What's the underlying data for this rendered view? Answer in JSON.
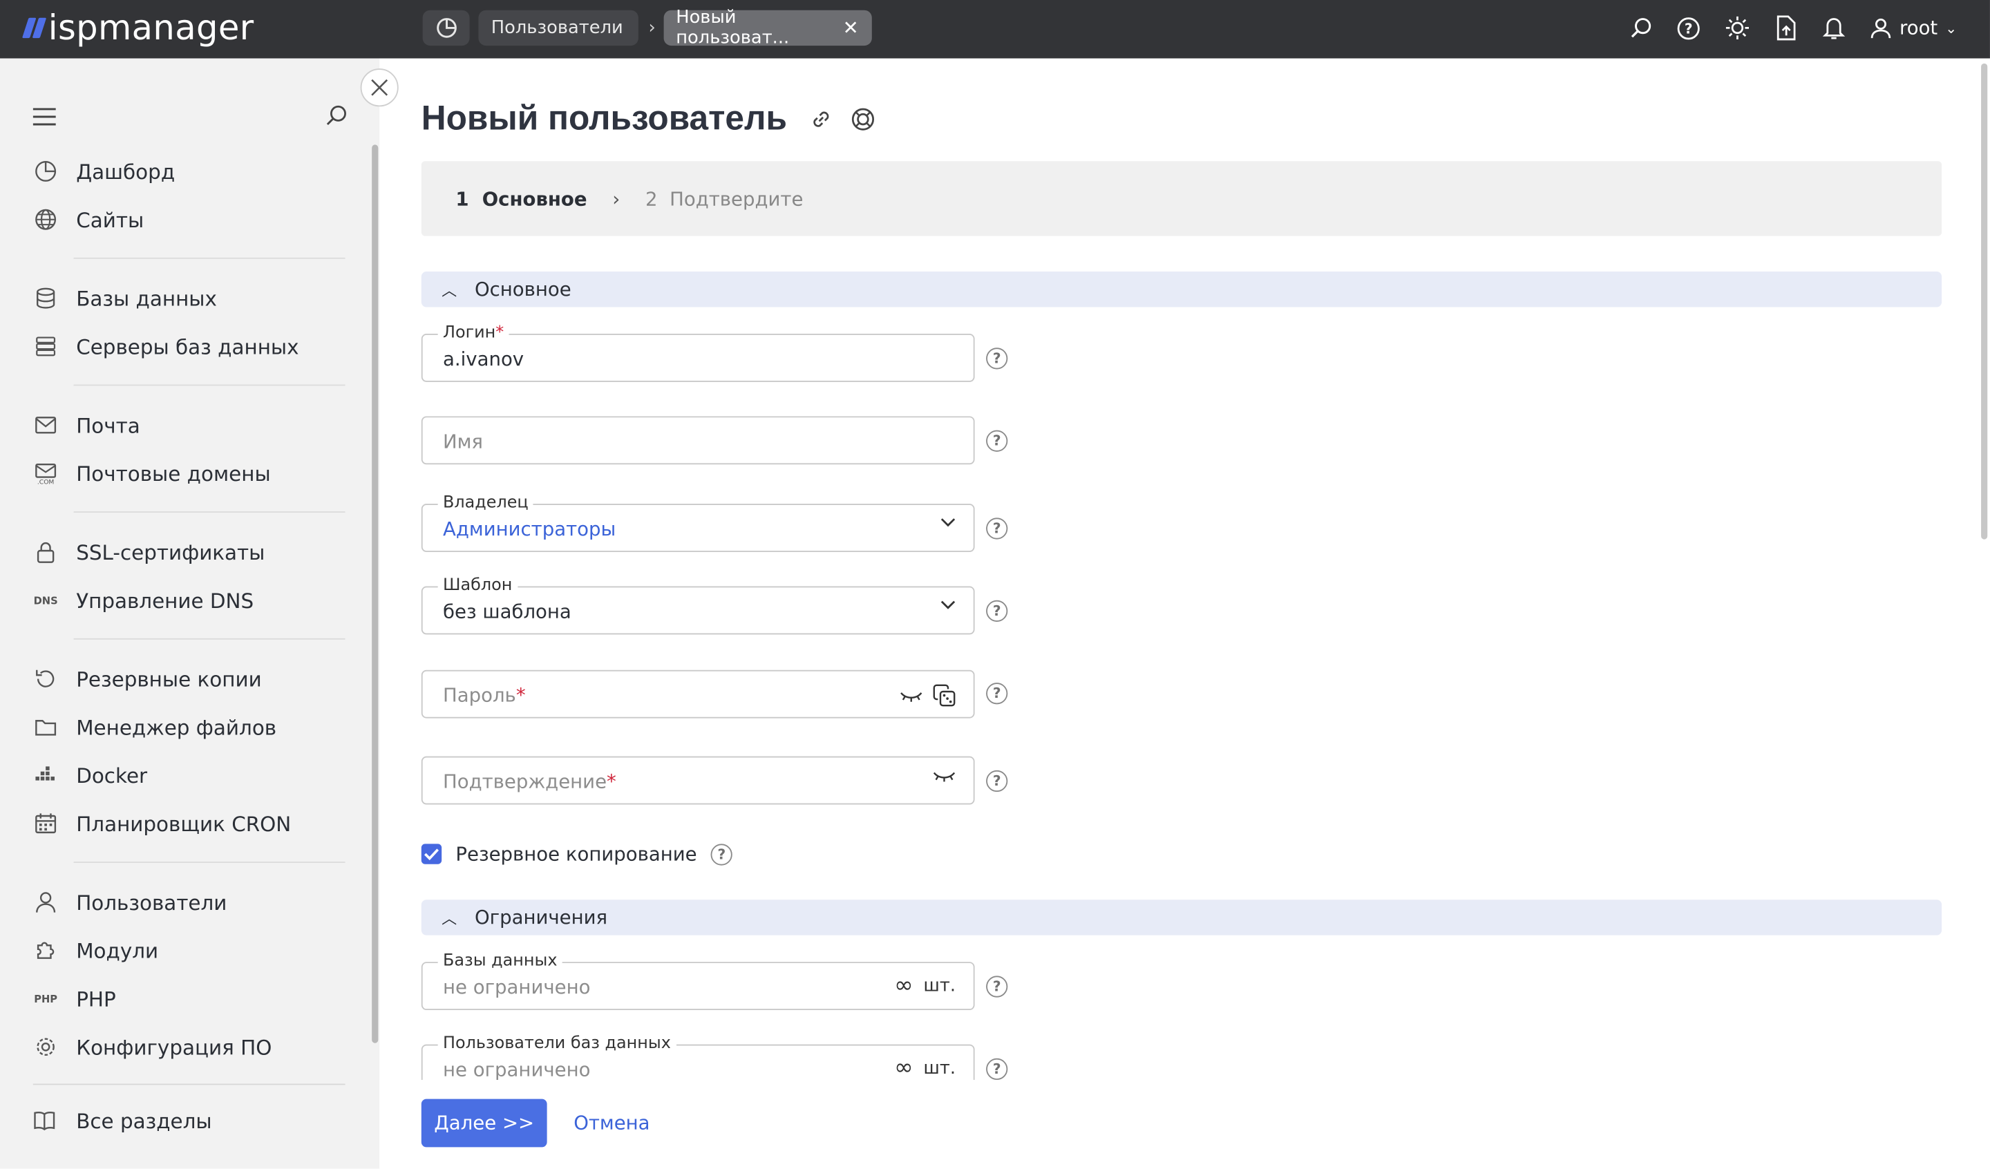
{
  "app": {
    "logo_text": "ispmanager"
  },
  "breadcrumbs": [
    {
      "label": "Пользователи"
    },
    {
      "label": "Новый пользоват..."
    }
  ],
  "topbar": {
    "user": "root"
  },
  "sidebar": {
    "items": [
      {
        "label": "Дашборд",
        "icon": "dashboard-icon"
      },
      {
        "label": "Сайты",
        "icon": "globe-icon"
      },
      {
        "label": "Базы данных",
        "icon": "database-icon"
      },
      {
        "label": "Серверы баз данных",
        "icon": "db-servers-icon"
      },
      {
        "label": "Почта",
        "icon": "mail-icon"
      },
      {
        "label": "Почтовые домены",
        "icon": "mail-domain-icon"
      },
      {
        "label": "SSL-сертификаты",
        "icon": "lock-icon"
      },
      {
        "label": "Управление DNS",
        "icon": "dns-icon"
      },
      {
        "label": "Резервные копии",
        "icon": "backup-icon"
      },
      {
        "label": "Менеджер файлов",
        "icon": "folder-icon"
      },
      {
        "label": "Docker",
        "icon": "docker-icon"
      },
      {
        "label": "Планировщик CRON",
        "icon": "calendar-icon"
      },
      {
        "label": "Пользователи",
        "icon": "user-icon"
      },
      {
        "label": "Модули",
        "icon": "puzzle-icon"
      },
      {
        "label": "PHP",
        "icon": "php-icon"
      },
      {
        "label": "Конфигурация ПО",
        "icon": "gear-icon"
      }
    ],
    "all_sections": "Все разделы"
  },
  "page": {
    "title": "Новый пользователь",
    "steps": [
      {
        "num": "1",
        "label": "Основное"
      },
      {
        "num": "2",
        "label": "Подтвердите"
      }
    ]
  },
  "form": {
    "section_main": "Основное",
    "login_label": "Логин",
    "login_value": "a.ivanov",
    "name_placeholder": "Имя",
    "owner_label": "Владелец",
    "owner_value": "Администраторы",
    "template_label": "Шаблон",
    "template_value": "без шаблона",
    "password_placeholder": "Пароль",
    "confirm_placeholder": "Подтверждение",
    "backup_label": "Резервное копирование",
    "backup_checked": true,
    "section_limits": "Ограничения",
    "db_label": "Базы данных",
    "db_placeholder": "не ограничено",
    "db_users_label": "Пользователи баз данных",
    "db_users_placeholder": "не ограничено",
    "unit": "шт.",
    "required_mark": "*",
    "help_mark": "?"
  },
  "footer": {
    "next": "Далее >>",
    "cancel": "Отмена"
  }
}
